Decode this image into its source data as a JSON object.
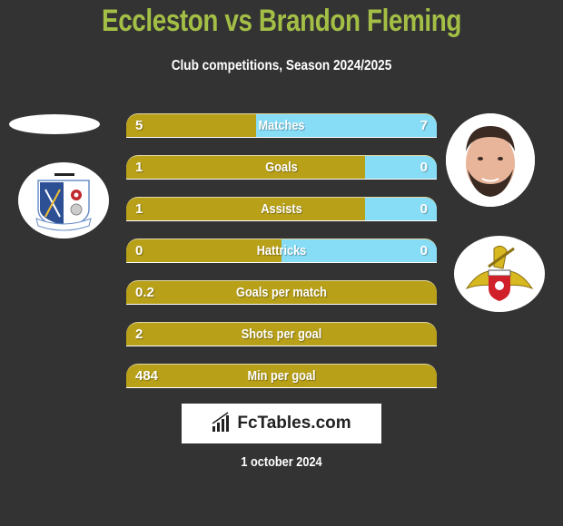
{
  "header": {
    "title": "Eccleston vs Brandon Fleming",
    "subtitle": "Club competitions, Season 2024/2025"
  },
  "colors": {
    "title": "#a4bf45",
    "left_bar": "#b8a019",
    "right_bar": "#87ddf6",
    "background": "#333333"
  },
  "left_team": {
    "name": "Barrow AFC",
    "logo_icon": "barrow-afc-crest-icon"
  },
  "right_player": {
    "name": "Brandon Fleming",
    "photo_icon": "player-photo"
  },
  "right_team": {
    "name": "Doncaster Rovers",
    "logo_icon": "doncaster-rovers-crest-icon"
  },
  "stats": [
    {
      "label": "Matches",
      "left": "5",
      "right": "7",
      "right_share": 0.583
    },
    {
      "label": "Goals",
      "left": "1",
      "right": "0",
      "right_share": 0.23
    },
    {
      "label": "Assists",
      "left": "1",
      "right": "0",
      "right_share": 0.23
    },
    {
      "label": "Hattricks",
      "left": "0",
      "right": "0",
      "right_share": 0.5
    },
    {
      "label": "Goals per match",
      "left": "0.2",
      "right": "",
      "right_share": 0
    },
    {
      "label": "Shots per goal",
      "left": "2",
      "right": "",
      "right_share": 0
    },
    {
      "label": "Min per goal",
      "left": "484",
      "right": "",
      "right_share": 0
    }
  ],
  "brand": {
    "text": "FcTables.com",
    "icon": "bar-chart-icon"
  },
  "footer": {
    "date": "1 october 2024"
  }
}
